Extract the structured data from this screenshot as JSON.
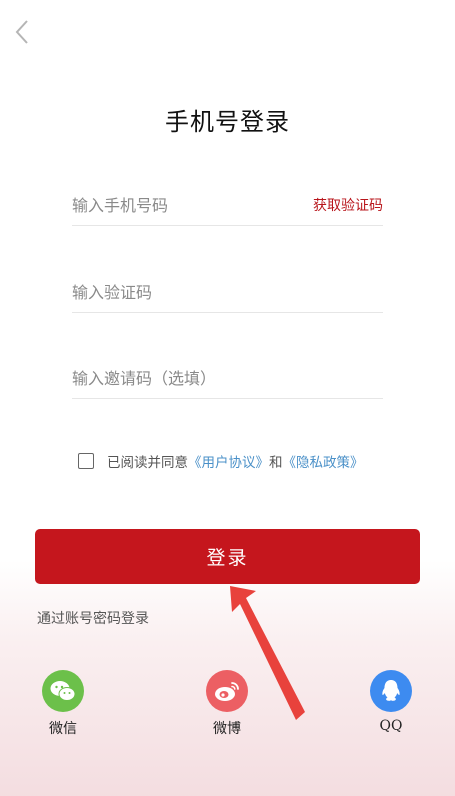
{
  "header": {
    "title": "手机号登录"
  },
  "form": {
    "phone_placeholder": "输入手机号码",
    "get_code_label": "获取验证码",
    "code_placeholder": "输入验证码",
    "invite_placeholder": "输入邀请码（选填）"
  },
  "agreement": {
    "prefix": "已阅读并同意",
    "user_agreement": "《用户协议》",
    "conjunction": "和",
    "privacy_policy": "《隐私政策》",
    "checked": false
  },
  "actions": {
    "login_label": "登录",
    "password_login_label": "通过账号密码登录"
  },
  "social": {
    "wechat": {
      "label": "微信",
      "icon": "wechat-icon",
      "color": "#6cc04a"
    },
    "weibo": {
      "label": "微博",
      "icon": "weibo-icon",
      "color": "#ec5f63"
    },
    "qq": {
      "label": "QQ",
      "icon": "qq-icon",
      "color": "#3d8bf0"
    }
  },
  "colors": {
    "accent": "#c5161d",
    "link": "#4a90c8"
  }
}
